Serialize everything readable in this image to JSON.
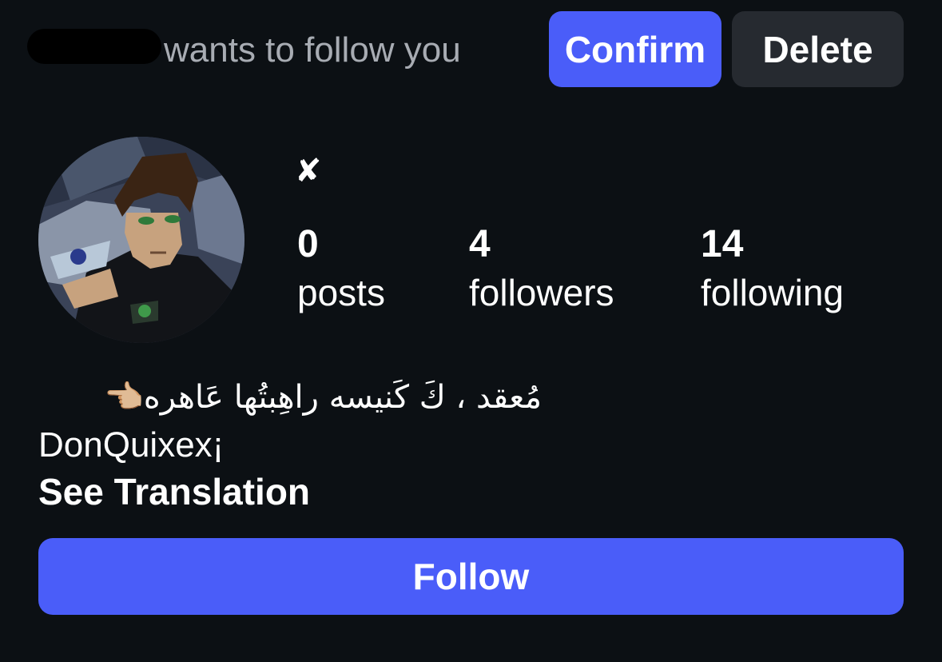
{
  "follow_request": {
    "text": "wants to follow you",
    "confirm_label": "Confirm",
    "delete_label": "Delete"
  },
  "profile": {
    "display_name": "✘",
    "stats": {
      "posts": {
        "count": "0",
        "label": "posts"
      },
      "followers": {
        "count": "4",
        "label": "followers"
      },
      "following": {
        "count": "14",
        "label": "following"
      }
    },
    "bio": {
      "line1": "مُعقد ، كَ كَنيسه راهِبتُها عَاهره👈🏼",
      "line2": "DonQuixex¡"
    },
    "see_translation_label": "See Translation",
    "follow_label": "Follow"
  },
  "colors": {
    "background": "#0c1014",
    "accent": "#4a5df9",
    "secondary_button": "#262a30",
    "muted_text": "#a8acb3"
  }
}
